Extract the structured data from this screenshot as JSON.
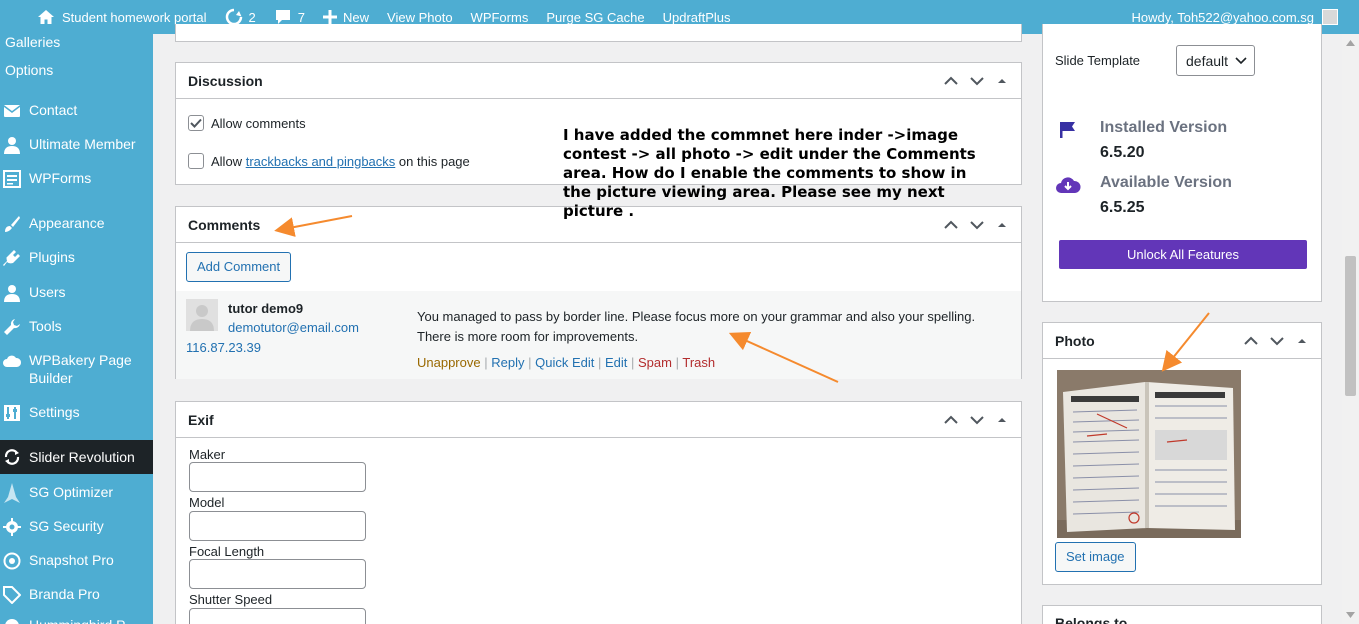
{
  "adminbar": {
    "site_name": "Student homework portal",
    "updates_count": "2",
    "comments_count": "7",
    "new_label": "New",
    "view_photo": "View Photo",
    "wpforms": "WPForms",
    "purge_cache": "Purge SG Cache",
    "updraftplus": "UpdraftPlus",
    "howdy": "Howdy, Toh522@yahoo.com.sg"
  },
  "sidebar": {
    "sub_items": [
      "Galleries",
      "Options"
    ],
    "items": [
      {
        "label": "Contact",
        "icon": "contact-icon"
      },
      {
        "label": "Ultimate Member",
        "icon": "user-icon"
      },
      {
        "label": "WPForms",
        "icon": "form-icon"
      },
      {
        "label": "Appearance",
        "icon": "paintbrush-icon"
      },
      {
        "label": "Plugins",
        "icon": "plug-icon"
      },
      {
        "label": "Users",
        "icon": "users-icon"
      },
      {
        "label": "Tools",
        "icon": "wrench-icon"
      },
      {
        "label": "WPBakery Page Builder",
        "icon": "cloud-icon"
      },
      {
        "label": "Settings",
        "icon": "settings-icon"
      },
      {
        "label": "Slider Revolution",
        "icon": "refresh-icon"
      },
      {
        "label": "SG Optimizer",
        "icon": "optimizer-icon"
      },
      {
        "label": "SG Security",
        "icon": "gear-icon"
      },
      {
        "label": "Snapshot Pro",
        "icon": "snapshot-icon"
      },
      {
        "label": "Branda Pro",
        "icon": "tag-icon"
      }
    ],
    "truncated_item": "Hummingbird P..."
  },
  "discussion": {
    "title": "Discussion",
    "allow_comments": "Allow comments",
    "allow_prefix": "Allow",
    "trackbacks_link": "trackbacks and pingbacks",
    "allow_suffix": "on this page"
  },
  "comments": {
    "title": "Comments",
    "add_button": "Add Comment",
    "author": "tutor demo9",
    "email": "demotutor@email.com",
    "ip": "116.87.23.39",
    "text": "You managed to pass by border line. Please focus more on your grammar and also your spelling. There is more room for improvements.",
    "actions": {
      "unapprove": "Unapprove",
      "reply": "Reply",
      "quick_edit": "Quick Edit",
      "edit": "Edit",
      "spam": "Spam",
      "trash": "Trash"
    }
  },
  "exif": {
    "title": "Exif",
    "fields": [
      "Maker",
      "Model",
      "Focal Length",
      "Shutter Speed"
    ]
  },
  "annotation": "I have added the commnet here inder ->image contest -> all photo -> edit under the Comments area. How do I enable the comments to show in the picture viewing area. Please see my next picture .",
  "right_panel": {
    "slide_template_label": "Slide Template",
    "slide_template_value": "default",
    "installed_label": "Installed Version",
    "installed_value": "6.5.20",
    "available_label": "Available Version",
    "available_value": "6.5.25",
    "unlock_button": "Unlock All Features"
  },
  "photo": {
    "title": "Photo",
    "set_image": "Set image"
  },
  "belongs_to": {
    "title": "Belongs to"
  },
  "colors": {
    "admin_blue": "#4eadd2",
    "unlock_purple": "#6236b8",
    "link_blue": "#2271b1",
    "arrow_orange": "#f58a2e",
    "spam_red": "#b32d2e",
    "unapprove_gold": "#996800"
  }
}
